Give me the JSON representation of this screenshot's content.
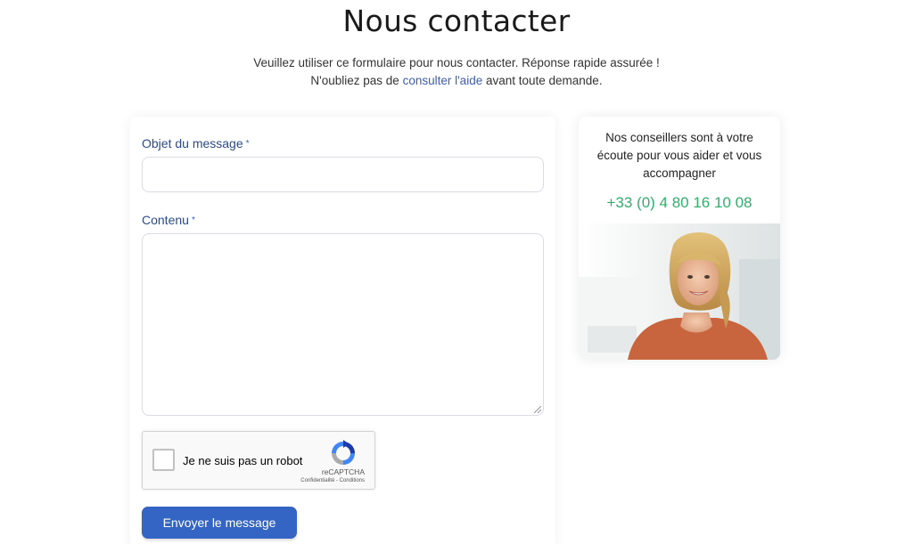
{
  "page": {
    "title": "Nous contacter",
    "intro_line1": "Veuillez utiliser ce formulaire pour nous contacter. Réponse rapide assurée !",
    "intro_line2_before": "N'oubliez pas de ",
    "intro_link": "consulter l'aide",
    "intro_line2_after": " avant toute demande."
  },
  "form": {
    "subject_label": "Objet du message",
    "subject_value": "",
    "content_label": "Contenu",
    "content_value": "",
    "required_marker": "*",
    "recaptcha": {
      "checkbox_label": "Je ne suis pas un robot",
      "brand": "reCAPTCHA",
      "terms": "Confidentialité - Conditions",
      "checked": false
    },
    "submit_label": "Envoyer le message"
  },
  "advisor": {
    "text": "Nos conseillers sont à votre écoute pour vous aider et vous accompagner",
    "phone": "+33 (0) 4 80 16 10 08"
  },
  "colors": {
    "accent": "#3565c4",
    "label": "#2d4a8a",
    "phone": "#2fb06a"
  }
}
